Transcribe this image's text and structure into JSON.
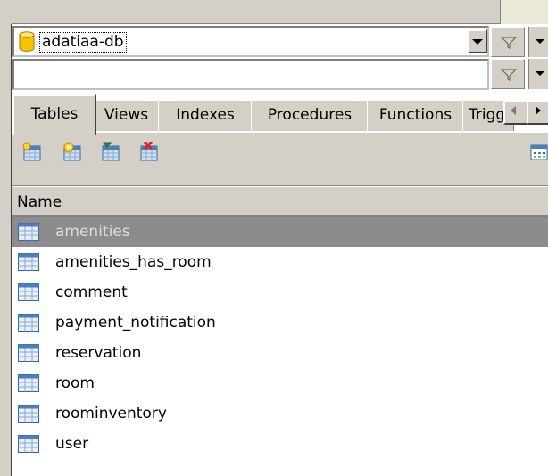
{
  "database": {
    "name": "adatiaa-db",
    "icon": "database-cylinder-icon"
  },
  "filter": {
    "value": "",
    "icon": "funnel-icon"
  },
  "tabs": {
    "items": [
      {
        "label": "Tables",
        "active": true
      },
      {
        "label": "Views"
      },
      {
        "label": "Indexes"
      },
      {
        "label": "Procedures"
      },
      {
        "label": "Functions"
      },
      {
        "label": "Trigg"
      }
    ]
  },
  "toolbar": {
    "buttons": [
      "new-table-icon",
      "new-table-wizard-icon",
      "edit-table-icon",
      "delete-table-icon"
    ],
    "view_toggle": "view-mode-icon"
  },
  "list": {
    "column": "Name",
    "rows": [
      {
        "name": "amenities",
        "selected": true
      },
      {
        "name": "amenities_has_room"
      },
      {
        "name": "comment"
      },
      {
        "name": "payment_notification"
      },
      {
        "name": "reservation"
      },
      {
        "name": "room"
      },
      {
        "name": "roominventory"
      },
      {
        "name": "user"
      }
    ]
  },
  "colors": {
    "selection": "#8c8c8c",
    "chrome": "#d4d0c8",
    "table_icon": "#4a7fc0"
  }
}
